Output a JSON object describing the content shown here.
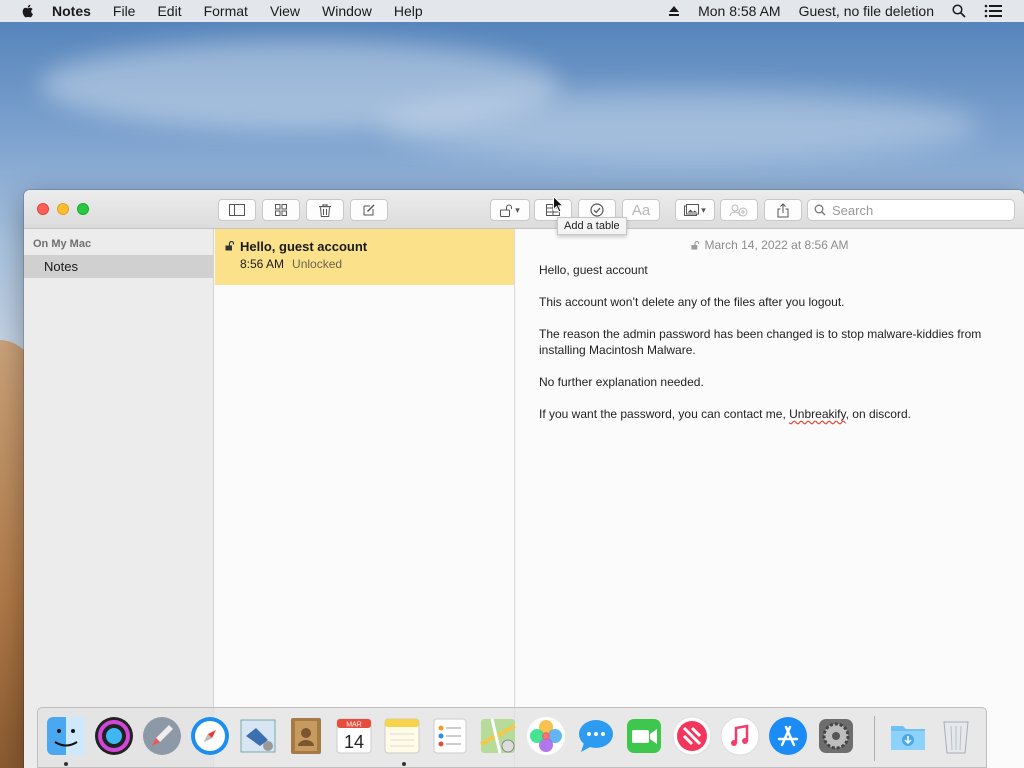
{
  "menubar": {
    "app_name": "Notes",
    "menus": [
      "File",
      "Edit",
      "Format",
      "View",
      "Window",
      "Help"
    ],
    "clock": "Mon 8:58 AM",
    "user": "Guest, no file deletion"
  },
  "window": {
    "toolbar": {
      "search_placeholder": "Search",
      "tooltip": "Add a table"
    },
    "sidebar": {
      "section": "On My Mac",
      "items": [
        {
          "label": "Notes"
        }
      ]
    },
    "note_list": [
      {
        "title": "Hello, guest account",
        "time": "8:56 AM",
        "status": "Unlocked"
      }
    ],
    "editor": {
      "date": "March 14, 2022 at 8:56 AM",
      "paragraphs": [
        "Hello, guest account",
        "This account won’t delete any of the files after you logout.",
        "The reason the admin password has been changed is to stop malware-kiddies from installing Macintosh Malware.",
        "No further explanation needed."
      ],
      "last_prefix": "If you want the password, you can contact me, ",
      "last_name": "Unbreakify",
      "last_suffix": ", on discord."
    }
  },
  "dock": {
    "apps": [
      "finder-icon",
      "siri-icon",
      "launchpad-icon",
      "safari-icon",
      "mail-icon",
      "contacts-icon",
      "calendar-icon",
      "notes-icon",
      "reminders-icon",
      "maps-icon",
      "photos-icon",
      "messages-icon",
      "facetime-icon",
      "news-icon",
      "music-icon",
      "app-store-icon",
      "system-preferences-icon",
      "downloads-folder-icon",
      "trash-icon"
    ],
    "calendar": {
      "month": "MAR",
      "day": "14"
    }
  },
  "colors": {
    "note_selected": "#fbe28a",
    "close": "#fe5f57",
    "minimize": "#febc2e",
    "maximize": "#28c840"
  }
}
